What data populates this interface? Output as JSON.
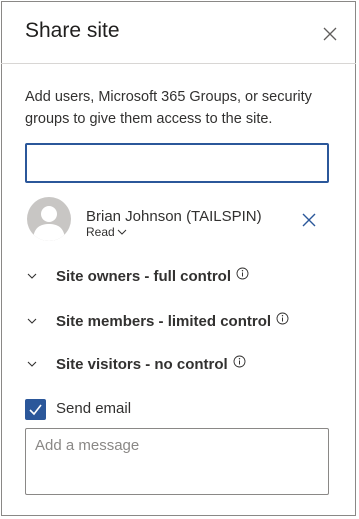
{
  "panel": {
    "title": "Share site",
    "description": "Add users, Microsoft 365 Groups, or security groups to give them access to the site."
  },
  "search": {
    "value": "",
    "placeholder": ""
  },
  "user": {
    "name": "Brian Johnson (TAILSPIN)",
    "permission": "Read"
  },
  "groups": [
    {
      "label": "Site owners - full control"
    },
    {
      "label": "Site members - limited control"
    },
    {
      "label": "Site visitors - no control"
    }
  ],
  "email": {
    "send_label": "Send email",
    "checked": true,
    "message_placeholder": "Add a message"
  },
  "colors": {
    "accent": "#2b579a",
    "text": "#323130"
  },
  "icons": {
    "close": "close-icon",
    "remove": "remove-user-icon",
    "chevron": "chevron-down-icon",
    "info": "info-icon",
    "check": "checkmark-icon",
    "avatar": "person-avatar-icon"
  }
}
